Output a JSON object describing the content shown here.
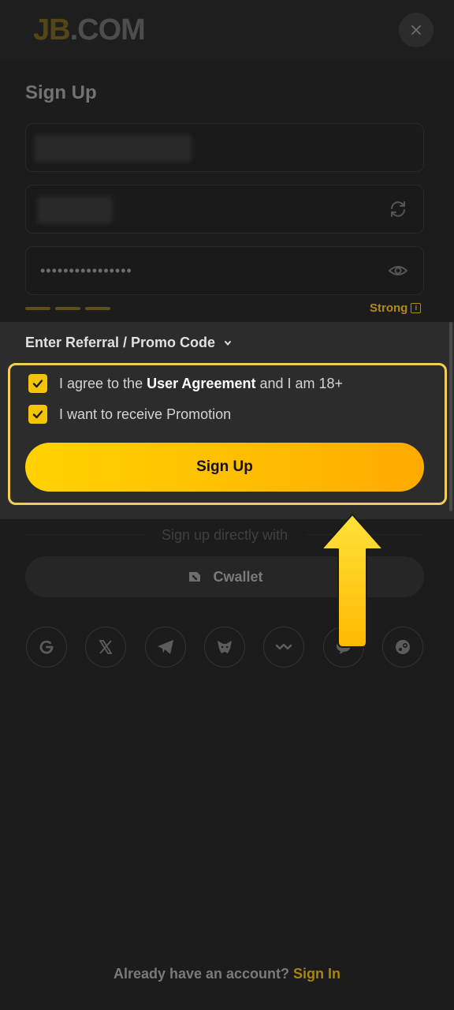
{
  "header": {
    "logo_main": "JB",
    "logo_suffix": ".COM",
    "close_label": "×"
  },
  "form": {
    "title": "Sign Up",
    "password_mask": "••••••••••••••••",
    "strength_label": "Strong",
    "strength_info_glyph": "i",
    "promo_toggle": "Enter Referral / Promo Code",
    "agreement_prefix": "I agree to the ",
    "agreement_link": "User Agreement",
    "agreement_suffix": " and I am 18+",
    "promotion_label": "I want to receive Promotion",
    "submit_label": "Sign Up"
  },
  "alternatives": {
    "divider": "Sign up directly with",
    "cwallet_label": "Cwallet",
    "social_icons": [
      "google-icon",
      "x-icon",
      "telegram-icon",
      "metamask-icon",
      "walletconnect-icon",
      "line-icon",
      "steam-icon"
    ]
  },
  "footer": {
    "prompt": "Already have an account? ",
    "sign_in": "Sign In"
  },
  "colors": {
    "accent": "#ffc400",
    "highlight_border": "#f5cd55",
    "background": "#1c1c1c"
  }
}
